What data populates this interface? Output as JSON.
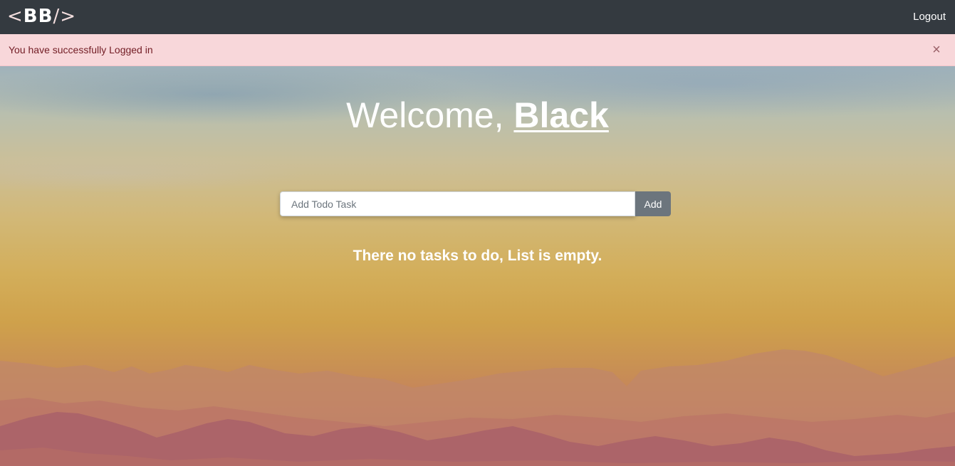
{
  "navbar": {
    "brand_open": "<",
    "brand_text": "BB",
    "brand_close": "/>",
    "logout_label": "Logout"
  },
  "alert": {
    "message": "You have successfully Logged in",
    "close_symbol": "×",
    "close_icon": "close-icon"
  },
  "hero": {
    "greeting": "Welcome, ",
    "username": "Black"
  },
  "todo": {
    "input_value": "",
    "input_placeholder": "Add Todo Task",
    "add_label": "Add",
    "empty_message": "There no tasks to do, List is empty."
  },
  "colors": {
    "navbar_bg": "#343a40",
    "alert_bg": "#f8d7da",
    "alert_text": "#721c24",
    "button_bg": "#6c757d"
  }
}
